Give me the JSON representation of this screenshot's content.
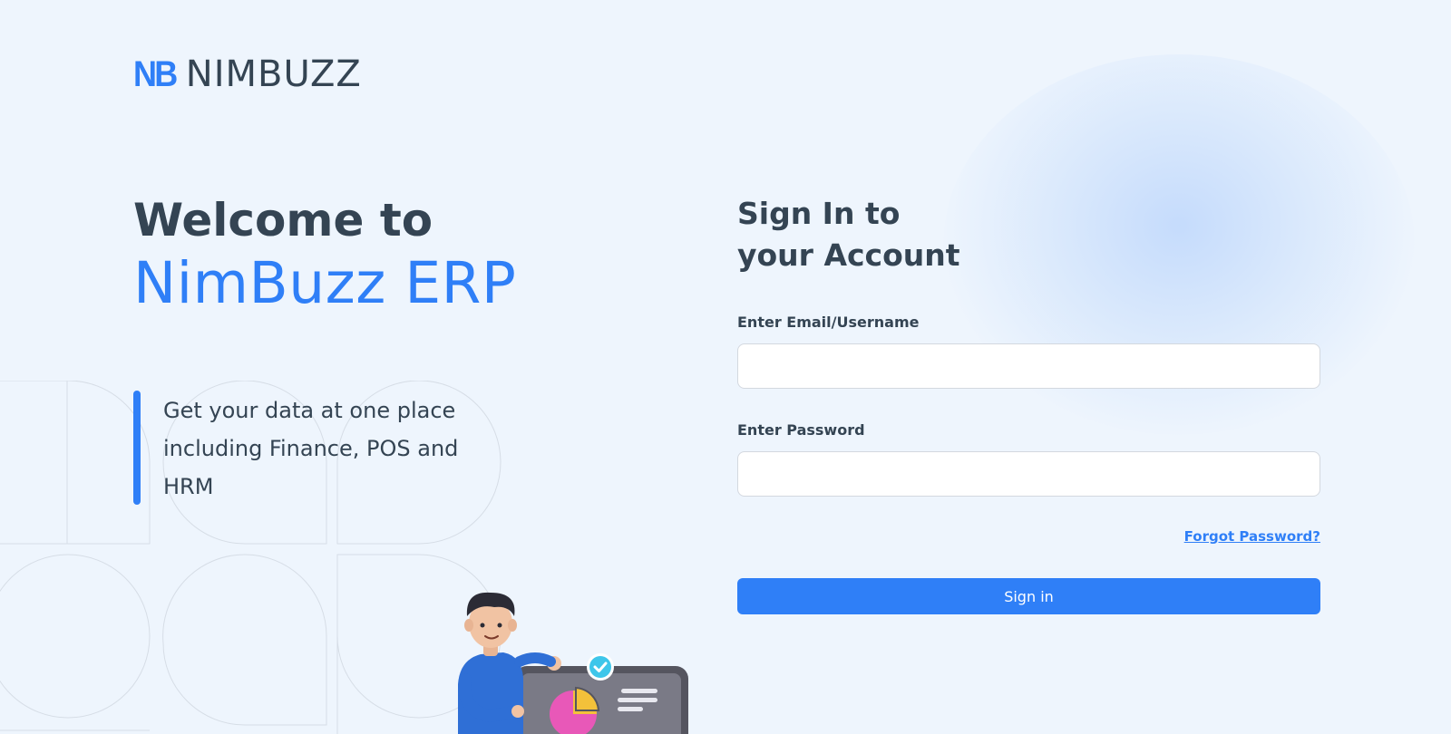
{
  "brand": {
    "logo_mark": "NB",
    "logo_text": "NIMBUZZ",
    "accent_color": "#2f7ff7",
    "text_color": "#344453"
  },
  "hero": {
    "welcome": "Welcome to",
    "product": "NimBuzz ERP",
    "tagline": "Get your data at one place including Finance, POS and HRM"
  },
  "signin": {
    "title_line1": "Sign In to",
    "title_line2": "your Account",
    "email_label": "Enter Email/Username",
    "email_value": "",
    "password_label": "Enter Password",
    "password_value": "",
    "forgot_link": "Forgot Password?",
    "submit_label": "Sign in"
  },
  "illustration": {
    "icon": "person-presenting-dashboard-icon"
  }
}
